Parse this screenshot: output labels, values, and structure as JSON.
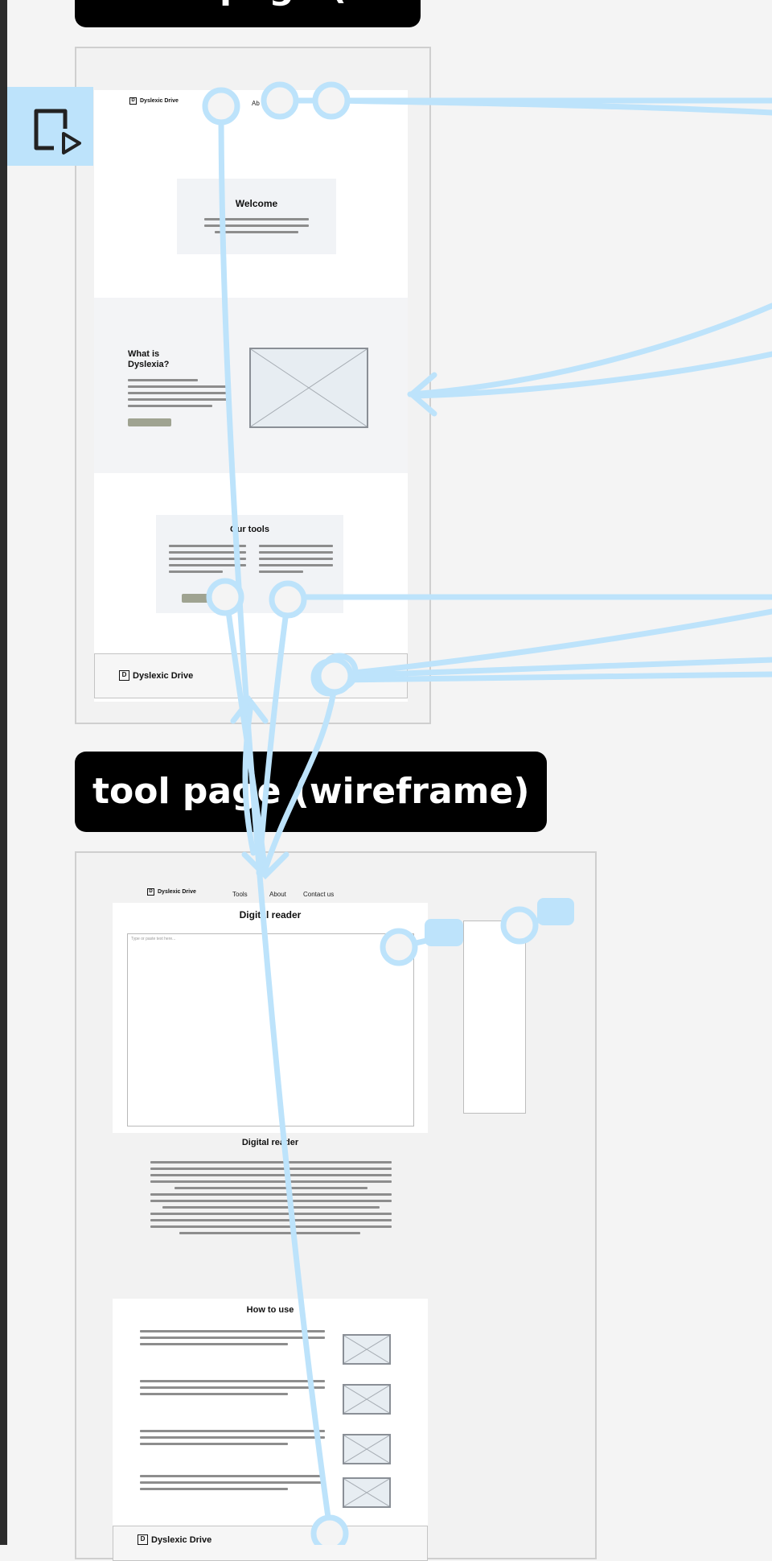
{
  "canvas": {
    "frame_labels": {
      "home": "Home page (wiref",
      "tool": "tool page (wireframe)"
    }
  },
  "home": {
    "logo_text": "Dyslexic Drive",
    "nav": [
      "Ab"
    ],
    "welcome_title": "Welcome",
    "about_title": "What is Dyslexia?",
    "tools_title": "Our tools",
    "footer_logo": "Dyslexic Drive"
  },
  "tool": {
    "logo_text": "Dyslexic Drive",
    "nav": [
      "Tools",
      "About",
      "Contact us"
    ],
    "reader_title": "Digital reader",
    "textarea_placeholder": "Type or paste text here...",
    "reader_info_title": "Digital reader",
    "howto_title": "How to use",
    "footer_logo": "Dyslexic Drive"
  },
  "colors": {
    "connector": "#bde3fb",
    "label_bg": "#000000",
    "button": "#9fa391"
  },
  "icons": {
    "play": "play-frame-icon",
    "placeholder_image": "image-placeholder-icon"
  }
}
